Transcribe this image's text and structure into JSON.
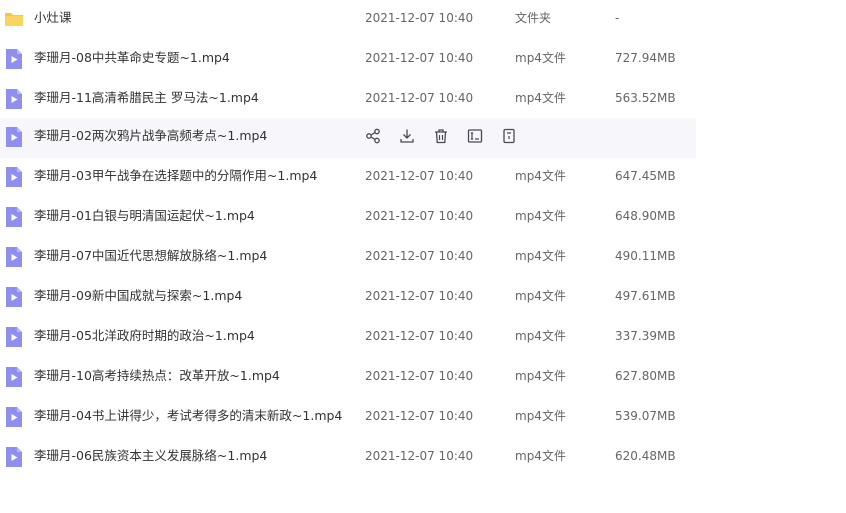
{
  "colors": {
    "folder": "#f7c54a",
    "video_icon": "#8f8ff0",
    "hover_row": "#f7f7fb",
    "action_icon": "#4a4a55"
  },
  "rows": [
    {
      "name": "小灶课",
      "date": "2021-12-07 10:40",
      "type": "文件夹",
      "size": "-",
      "icon": "folder-icon"
    },
    {
      "name": "李珊月-08中共革命史专题~1.mp4",
      "date": "2021-12-07 10:40",
      "type": "mp4文件",
      "size": "727.94MB",
      "icon": "video-file-icon"
    },
    {
      "name": "李珊月-11高清希腊民主 罗马法~1.mp4",
      "date": "2021-12-07 10:40",
      "type": "mp4文件",
      "size": "563.52MB",
      "icon": "video-file-icon"
    },
    {
      "name": "李珊月-02两次鸦片战争高频考点~1.mp4",
      "date": "",
      "type": "",
      "size": "",
      "icon": "video-file-icon",
      "hovered": true
    },
    {
      "name": "李珊月-03甲午战争在选择题中的分隔作用~1.mp4",
      "date": "2021-12-07 10:40",
      "type": "mp4文件",
      "size": "647.45MB",
      "icon": "video-file-icon"
    },
    {
      "name": "李珊月-01白银与明清国运起伏~1.mp4",
      "date": "2021-12-07 10:40",
      "type": "mp4文件",
      "size": "648.90MB",
      "icon": "video-file-icon"
    },
    {
      "name": "李珊月-07中国近代思想解放脉络~1.mp4",
      "date": "2021-12-07 10:40",
      "type": "mp4文件",
      "size": "490.11MB",
      "icon": "video-file-icon"
    },
    {
      "name": "李珊月-09新中国成就与探索~1.mp4",
      "date": "2021-12-07 10:40",
      "type": "mp4文件",
      "size": "497.61MB",
      "icon": "video-file-icon"
    },
    {
      "name": "李珊月-05北洋政府时期的政治~1.mp4",
      "date": "2021-12-07 10:40",
      "type": "mp4文件",
      "size": "337.39MB",
      "icon": "video-file-icon"
    },
    {
      "name": "李珊月-10高考持续热点：改革开放~1.mp4",
      "date": "2021-12-07 10:40",
      "type": "mp4文件",
      "size": "627.80MB",
      "icon": "video-file-icon"
    },
    {
      "name": "李珊月-04书上讲得少，考试考得多的清末新政~1.mp4",
      "date": "2021-12-07 10:40",
      "type": "mp4文件",
      "size": "539.07MB",
      "icon": "video-file-icon"
    },
    {
      "name": "李珊月-06民族资本主义发展脉络~1.mp4",
      "date": "2021-12-07 10:40",
      "type": "mp4文件",
      "size": "620.48MB",
      "icon": "video-file-icon"
    }
  ],
  "hover_actions": [
    {
      "icon": "share-icon"
    },
    {
      "icon": "download-icon"
    },
    {
      "icon": "delete-icon"
    },
    {
      "icon": "rename-icon"
    },
    {
      "icon": "more-icon"
    }
  ]
}
